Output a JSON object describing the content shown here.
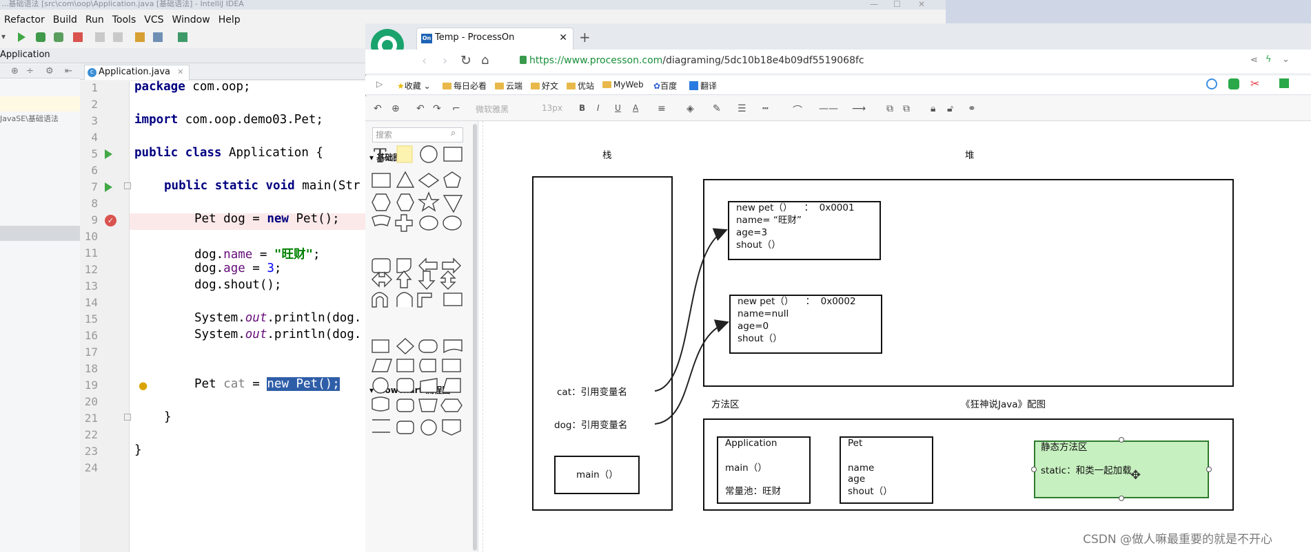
{
  "ide": {
    "title_text": "...基础语法 [src\\com\\oop\\Application.java [基础语法] - IntelliJ IDEA",
    "menu": [
      "Refactor",
      "Build",
      "Run",
      "Tools",
      "VCS",
      "Window",
      "Help"
    ],
    "breadcrumb": "Application",
    "project_label": "JavaSE\\基础语法",
    "tab_label": "Application.java",
    "line_numbers": [
      "1",
      "2",
      "3",
      "4",
      "5",
      "6",
      "7",
      "8",
      "9",
      "10",
      "11",
      "12",
      "13",
      "14",
      "15",
      "16",
      "17",
      "18",
      "19",
      "20",
      "21",
      "22",
      "23",
      "24"
    ],
    "code": {
      "l1_kw": "package",
      "l1_rest": " com.oop;",
      "l3_kw": "import",
      "l3_rest": " com.oop.demo03.Pet;",
      "l5_kw": "public class",
      "l5_rest": " Application {",
      "l7_kw": "public static void",
      "l7_rest": " main(Str",
      "l9_a": "Pet dog = ",
      "l9_kw": "new",
      "l9_b": " Pet();",
      "l11_a": "dog.",
      "l11_f": "name",
      "l11_b": " = ",
      "l11_s": "\"旺财\"",
      "l11_c": ";",
      "l12_a": "dog.",
      "l12_f": "age",
      "l12_b": " = ",
      "l12_n": "3",
      "l12_c": ";",
      "l13": "dog.shout();",
      "l15_a": "System.",
      "l15_o": "out",
      "l15_b": ".println(dog.",
      "l16_a": "System.",
      "l16_o": "out",
      "l16_b": ".println(dog.",
      "l19_a": "Pet ",
      "l19_v": "cat",
      "l19_b": " = ",
      "l19_sel": "new Pet();",
      "l21": "}",
      "l23": "}"
    }
  },
  "browser": {
    "tab_title": "Temp - ProcessOn",
    "tab_favicon": "On",
    "url_host": "https://www.processon.com",
    "url_path": "/diagraming/5dc10b18e4b09df5519068fc",
    "bookmarks": [
      "收藏",
      "每日必看",
      "云端",
      "好文",
      "优站",
      "MyWeb",
      "百度",
      "翻译"
    ]
  },
  "processon": {
    "toolbar": {
      "font": "微软雅黑",
      "size": "13px"
    },
    "search_placeholder": "搜索",
    "section_basic": "基础图形",
    "section_flowchart": "Flowchart 流程图"
  },
  "diagram": {
    "stack_label": "栈",
    "heap_label": "堆",
    "method_area_label": "方法区",
    "caption": "《狂神说Java》配图",
    "cat_ref": "cat：引用变量名",
    "dog_ref": "dog：引用变量名",
    "main": "main（）",
    "obj1": [
      "new pet（）    ：  0x0001",
      "name= “旺财”",
      "age=3",
      "shout（）"
    ],
    "obj2": [
      "new pet（）    ：  0x0002",
      "name=null",
      "age=0",
      "shout（）"
    ],
    "application_box": {
      "title": "Application",
      "l1": "main（）",
      "l2": "常量池：旺财"
    },
    "pet_box": {
      "title": "Pet",
      "lines": [
        "name",
        "age",
        "shout（）"
      ]
    },
    "static_box": {
      "title": "静态方法区",
      "text": "static：和类一起加载"
    },
    "colors": {
      "static_fill": "#c7f0c0",
      "static_border": "#2d7a2d"
    }
  },
  "watermark": "CSDN @做人嘛最重要的就是不开心"
}
